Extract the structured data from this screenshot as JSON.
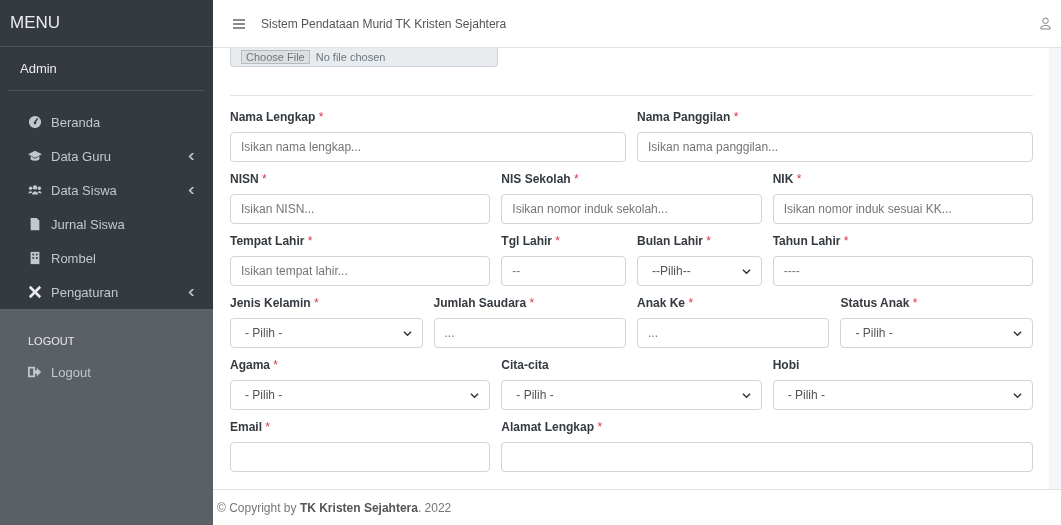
{
  "sidebar": {
    "brand": "MENU",
    "user": "Admin",
    "items": [
      {
        "label": "Beranda",
        "has_submenu": false
      },
      {
        "label": "Data Guru",
        "has_submenu": true
      },
      {
        "label": "Data Siswa",
        "has_submenu": true
      },
      {
        "label": "Jurnal Siswa",
        "has_submenu": false
      },
      {
        "label": "Rombel",
        "has_submenu": false
      },
      {
        "label": "Pengaturan",
        "has_submenu": true
      }
    ],
    "section": "LOGOUT",
    "logout_items": [
      {
        "label": "Logout"
      }
    ]
  },
  "header": {
    "title": "Sistem Pendataan Murid TK Kristen Sejahtera"
  },
  "file_input": {
    "button": "Choose File",
    "status": "No file chosen"
  },
  "form_rows": [
    [
      {
        "label": "Nama Lengkap",
        "required_mark": "*",
        "kind": "input",
        "placeholder": "Isikan nama lengkap..."
      },
      {
        "label": "Nama Panggilan",
        "required_mark": "*",
        "kind": "input",
        "placeholder": "Isikan nama panggilan..."
      }
    ],
    [
      {
        "label": "NISN",
        "required_mark": "*",
        "kind": "input",
        "placeholder": "Isikan NISN..."
      },
      {
        "label": "NIS Sekolah",
        "required_mark": "*",
        "kind": "input",
        "placeholder": "Isikan nomor induk sekolah..."
      },
      {
        "label": "NIK",
        "required_mark": "*",
        "kind": "input",
        "placeholder": "Isikan nomor induk sesuai KK..."
      }
    ],
    [
      {
        "label": "Tempat Lahir",
        "required_mark": "*",
        "kind": "input",
        "placeholder": "Isikan tempat lahir..."
      },
      {
        "label": "Tgl Lahir",
        "required_mark": "*",
        "kind": "input",
        "placeholder": "--"
      },
      {
        "label": "Bulan Lahir",
        "required_mark": "*",
        "kind": "select",
        "value": "--Pilih--"
      },
      {
        "label": "Tahun Lahir",
        "required_mark": "*",
        "kind": "input",
        "placeholder": "----"
      }
    ],
    [
      {
        "label": "Jenis Kelamin",
        "required_mark": "*",
        "kind": "select",
        "value": "- Pilih -"
      },
      {
        "label": "Jumlah Saudara",
        "required_mark": "*",
        "kind": "input",
        "placeholder": "..."
      },
      {
        "label": "Anak Ke",
        "required_mark": "*",
        "kind": "input",
        "placeholder": "..."
      },
      {
        "label": "Status Anak",
        "required_mark": "*",
        "kind": "select",
        "value": "- Pilih -"
      }
    ],
    [
      {
        "label": "Agama",
        "required_mark": "*",
        "kind": "select",
        "value": "- Pilih -"
      },
      {
        "label": "Cita-cita",
        "kind": "select",
        "value": "- Pilih -"
      },
      {
        "label": "Hobi",
        "kind": "select",
        "value": "- Pilih -"
      }
    ],
    [
      {
        "label": "Email",
        "required_mark": "*",
        "kind": "input"
      },
      {
        "label": "Alamat Lengkap",
        "required_mark": "*",
        "kind": "input"
      }
    ]
  ],
  "footer": {
    "text": "© Copyright by **TK Kristen Sejahtera**. 2022"
  }
}
